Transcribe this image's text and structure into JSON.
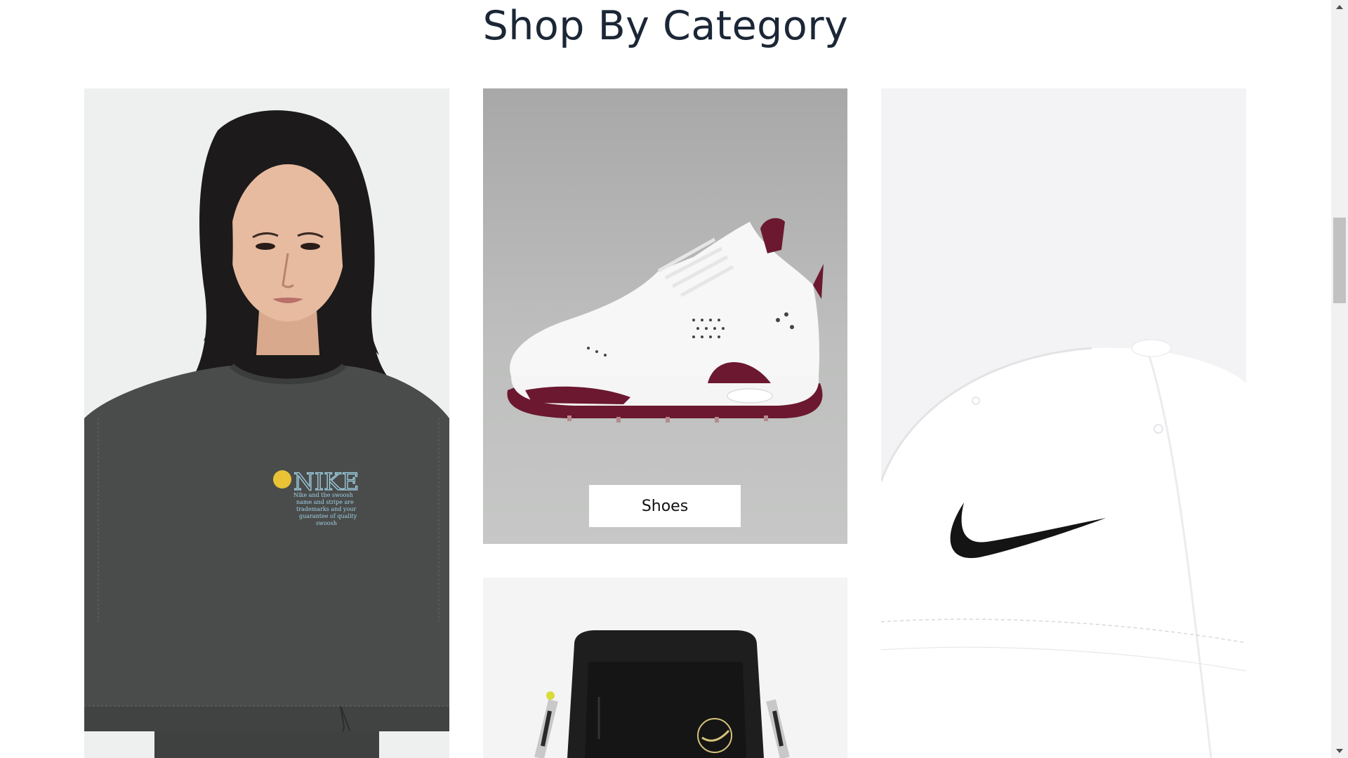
{
  "section": {
    "title": "Shop By Category"
  },
  "categories": [
    {
      "id": "apparel",
      "image": "woman-in-grey-crop-sweatshirt"
    },
    {
      "id": "shoes",
      "image": "white-maroon-golf-sneaker",
      "button_label": "Shoes"
    },
    {
      "id": "bags",
      "image": "black-crossbody-bag"
    },
    {
      "id": "hats",
      "image": "white-cap-with-black-swoosh"
    }
  ],
  "shirt_print": {
    "logo": "NIKE",
    "tagline": [
      "Nike and the swoosh",
      "name and stripe are",
      "trademarks and your",
      "guarantee of quality",
      "swoosh"
    ]
  },
  "colors": {
    "title": "#1b2636",
    "accent_maroon": "#6b1830",
    "shirt": "#4a4c4b"
  }
}
